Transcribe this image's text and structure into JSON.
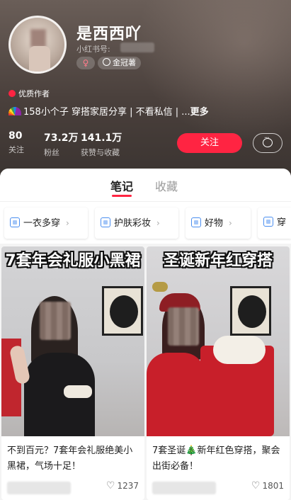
{
  "profile": {
    "nickname": "是西西吖",
    "account_label": "小红书号:",
    "gender_symbol": "♀",
    "badge_label": "金冠薯",
    "quality_author": "优质作者",
    "bio": "158小个子 穿搭家居分享 | 不看私信 | ...",
    "bio_more": "更多",
    "stats": [
      {
        "value": "80",
        "label": "关注"
      },
      {
        "value": "73.2万",
        "label": "粉丝"
      },
      {
        "value": "141.1万",
        "label": "获赞与收藏"
      }
    ],
    "follow_label": "关注"
  },
  "tabs": [
    {
      "label": "笔记",
      "active": true
    },
    {
      "label": "收藏",
      "active": false
    }
  ],
  "collections": [
    {
      "label": "一衣多穿"
    },
    {
      "label": "护肤彩妆"
    },
    {
      "label": "好物"
    },
    {
      "label": "穿"
    }
  ],
  "notes": [
    {
      "cover_title": "7套年会礼服小黑裙",
      "caption": "不到百元？7套年会礼服绝美小黑裙，气场十足！",
      "likes": "1237"
    },
    {
      "cover_title": "圣诞新年红穿搭",
      "caption": "7套圣诞🎄新年红色穿搭，聚会出街必备！",
      "likes": "1801"
    }
  ],
  "colors": {
    "accent": "#ff2442",
    "link_blue": "#4a8ef0"
  },
  "icons": {
    "message": "chat-bubble-icon",
    "heart": "heart-outline-icon",
    "collection": "album-icon",
    "chevron": "chevron-right-icon"
  }
}
